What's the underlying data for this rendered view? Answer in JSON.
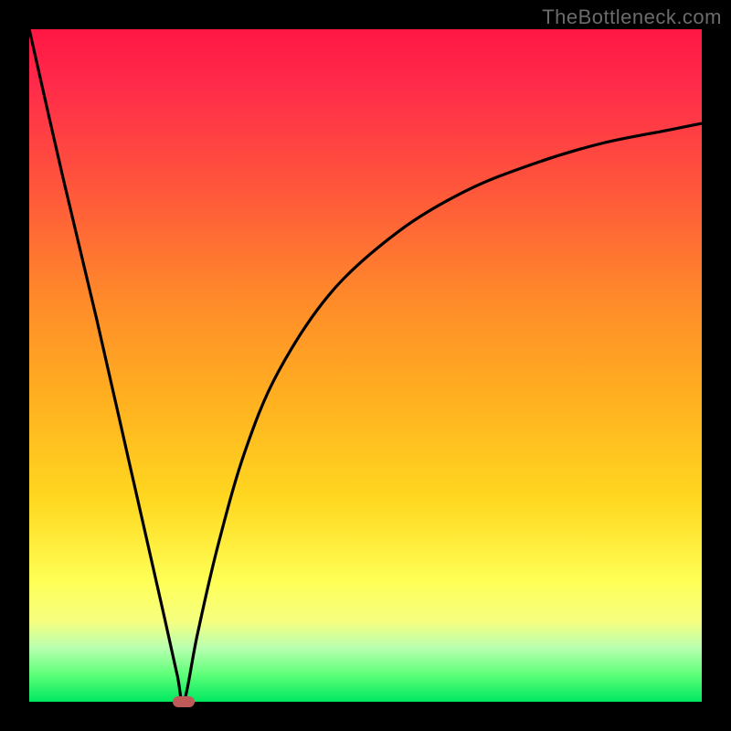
{
  "attribution": "TheBottleneck.com",
  "colors": {
    "frame": "#000000",
    "gradient_top": "#ff1744",
    "gradient_bottom": "#00e860",
    "curve": "#000000",
    "marker": "#c05a58"
  },
  "chart_data": {
    "type": "line",
    "title": "",
    "xlabel": "",
    "ylabel": "",
    "xlim": [
      0,
      100
    ],
    "ylim": [
      0,
      100
    ],
    "series": [
      {
        "name": "left-branch",
        "x": [
          0,
          5,
          10,
          15,
          20,
          22,
          23
        ],
        "values": [
          100,
          78,
          57,
          35,
          13,
          4,
          0
        ]
      },
      {
        "name": "right-branch",
        "x": [
          23,
          25,
          28,
          32,
          37,
          45,
          55,
          65,
          75,
          85,
          95,
          100
        ],
        "values": [
          0,
          10,
          23,
          37,
          49,
          61,
          70,
          76,
          80,
          83,
          85,
          86
        ]
      }
    ],
    "annotations": [
      {
        "name": "optimal-marker",
        "x": 23,
        "y": 0
      }
    ]
  }
}
